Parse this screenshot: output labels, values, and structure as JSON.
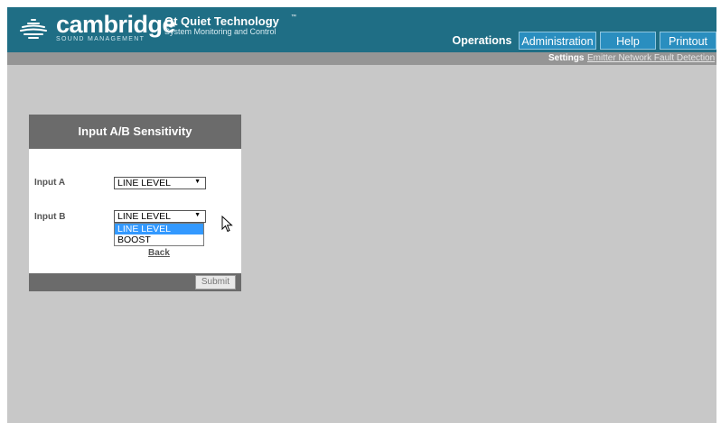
{
  "brand": {
    "name": "cambridge",
    "tagline": "SOUND MANAGEMENT",
    "trademark": "™"
  },
  "product": {
    "title": "Qt Quiet Technology",
    "subtitle": "System Monitoring and Control",
    "trademark": "™"
  },
  "nav": {
    "tabs": [
      {
        "label": "Operations",
        "active": true
      },
      {
        "label": "Administration",
        "active": false
      },
      {
        "label": "Help",
        "active": false
      },
      {
        "label": "Printout",
        "active": false
      }
    ]
  },
  "subnav": {
    "settings": "Settings",
    "emitter": "Emitter Network Fault Detection"
  },
  "panel": {
    "title": "Input A/B Sensitivity",
    "input_a": {
      "label": "Input A",
      "value": "LINE LEVEL"
    },
    "input_b": {
      "label": "Input B",
      "value": "LINE LEVEL"
    },
    "options": [
      "LINE LEVEL",
      "BOOST"
    ],
    "back": "Back",
    "submit": "Submit"
  },
  "colors": {
    "header": "#1f6e85",
    "tab_inactive": "#2a8ebf",
    "highlight": "#3399ff"
  }
}
